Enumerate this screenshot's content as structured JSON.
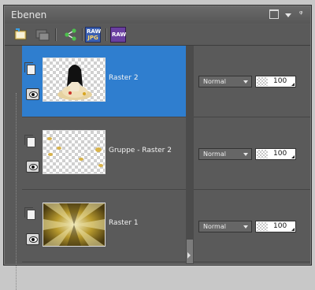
{
  "panel": {
    "title": "Ebenen"
  },
  "toolbar": {
    "tools": [
      {
        "name": "new-layer-icon"
      },
      {
        "name": "merge-layer-icon"
      },
      {
        "name": "link-layers-icon"
      },
      {
        "name": "raw-jpg-icon",
        "label_top": "RAW",
        "label_bottom": "JPG"
      },
      {
        "name": "raw-icon",
        "label": "RAW"
      }
    ]
  },
  "layers": [
    {
      "name": "Raster 2",
      "blend_mode": "Normal",
      "opacity": "100",
      "selected": true,
      "visible": true
    },
    {
      "name": "Gruppe - Raster 2",
      "blend_mode": "Normal",
      "opacity": "100",
      "selected": false,
      "visible": true
    },
    {
      "name": "Raster 1",
      "blend_mode": "Normal",
      "opacity": "100",
      "selected": false,
      "visible": true
    }
  ],
  "colors": {
    "selected_row": "#2f7ecf",
    "panel_bg": "#5a5a5a"
  }
}
